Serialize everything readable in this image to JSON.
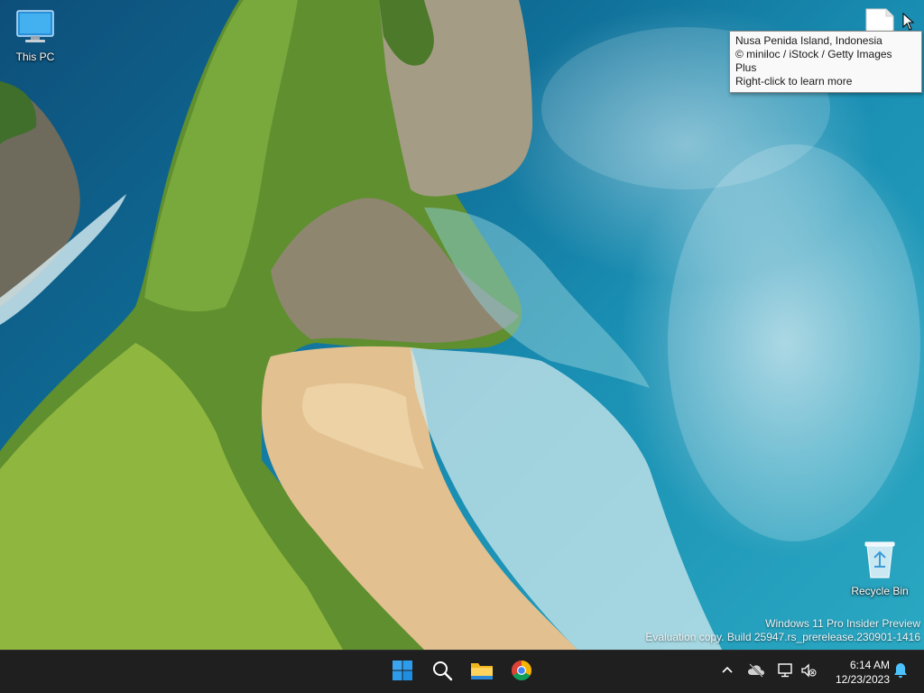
{
  "desktop": {
    "icons": [
      {
        "label": "This PC",
        "icon": "monitor-icon"
      },
      {
        "label": "Recycle Bin",
        "icon": "recycle-bin-icon"
      }
    ],
    "tooltip": {
      "line1": "Nusa Penida Island, Indonesia",
      "line2": "© miniloc / iStock / Getty Images Plus",
      "line3": "Right-click to learn more"
    },
    "watermark": {
      "line1": "Windows 11 Pro Insider Preview",
      "line2": "Evaluation copy. Build 25947.rs_prerelease.230901-1416"
    }
  },
  "taskbar": {
    "apps": [
      "windows-start-icon",
      "search-icon",
      "file-explorer-icon",
      "chrome-icon"
    ],
    "tray": [
      "chevron-up-icon",
      "cloud-offline-icon",
      "network-icon",
      "volume-muted-icon"
    ],
    "clock": {
      "time": "6:14 AM",
      "date": "12/23/2023"
    },
    "colors": {
      "background": "#1f1f1f",
      "accent": "#0078d4",
      "notification": "#4cc2ff"
    }
  }
}
